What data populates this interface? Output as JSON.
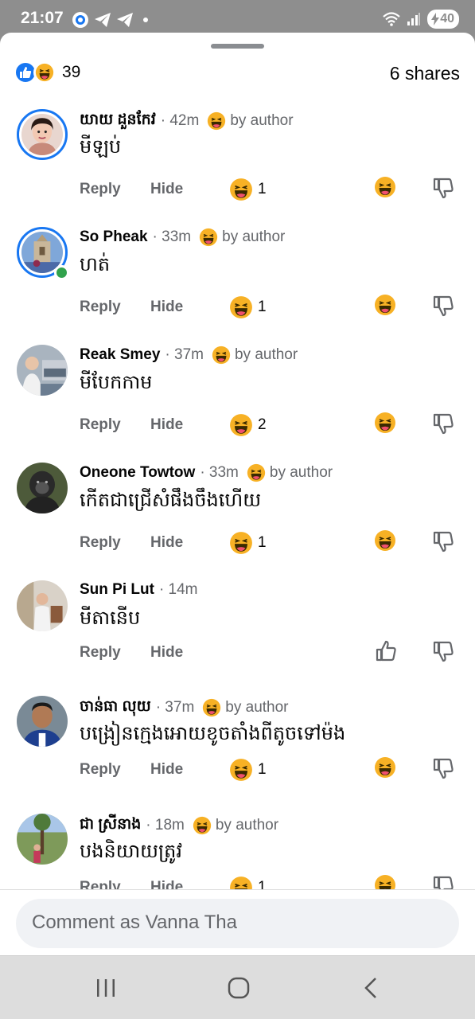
{
  "status_bar": {
    "time": "21:07",
    "battery": "40",
    "icons": [
      "messenger-icon",
      "telegram-icon",
      "telegram-icon",
      "dot-icon",
      "wifi-icon",
      "signal-icon",
      "battery-icon"
    ]
  },
  "summary": {
    "reaction_count": "39",
    "shares": "6 shares",
    "reactions": [
      "like",
      "haha"
    ]
  },
  "comments": [
    {
      "name": "យាយ ដួនកែវ",
      "time": "· 42m",
      "by_author": "by author",
      "text": "មីឡប់",
      "reaction_count": "1",
      "author_reacted": true,
      "user_reaction": "haha",
      "avatar": "ring"
    },
    {
      "name": "So Pheak",
      "time": "· 33m",
      "by_author": "by author",
      "text": "ហត់",
      "reaction_count": "1",
      "author_reacted": true,
      "user_reaction": "haha",
      "avatar": "ring-online"
    },
    {
      "name": "Reak Smey",
      "time": "· 37m",
      "by_author": "by author",
      "text": "មីបែកកាម",
      "reaction_count": "2",
      "author_reacted": true,
      "user_reaction": "haha",
      "avatar": "plain"
    },
    {
      "name": "Oneone Towtow",
      "time": "· 33m",
      "by_author": "by author",
      "text": "កើតជាជ្រើសំផឹងចឹងហើយ",
      "reaction_count": "1",
      "author_reacted": true,
      "user_reaction": "haha",
      "avatar": "plain"
    },
    {
      "name": "Sun Pi Lut",
      "time": "· 14m",
      "by_author": "",
      "text": "មីតានើប",
      "reaction_count": "",
      "author_reacted": false,
      "user_reaction": "like",
      "avatar": "plain"
    },
    {
      "name": "ចាន់ធា លុយ",
      "time": "· 37m",
      "by_author": "by author",
      "text": "បង្រៀនក្មេងអោយខូចតាំងពីតូចទៅម៉ង",
      "reaction_count": "1",
      "author_reacted": true,
      "user_reaction": "haha",
      "avatar": "plain"
    },
    {
      "name": "ជា ស្រីនាង",
      "time": "· 18m",
      "by_author": "by author",
      "text": "បងនិយាយត្រូវ",
      "reaction_count": "1",
      "author_reacted": true,
      "user_reaction": "haha",
      "avatar": "plain"
    }
  ],
  "labels": {
    "reply": "Reply",
    "hide": "Hide"
  },
  "input": {
    "placeholder": "Comment as Vanna Tha"
  },
  "nav": [
    "recent-apps-icon",
    "home-icon",
    "back-icon"
  ],
  "colors": {
    "accent": "#1877f2",
    "online": "#31a24c",
    "secondary_text": "#65676b"
  }
}
